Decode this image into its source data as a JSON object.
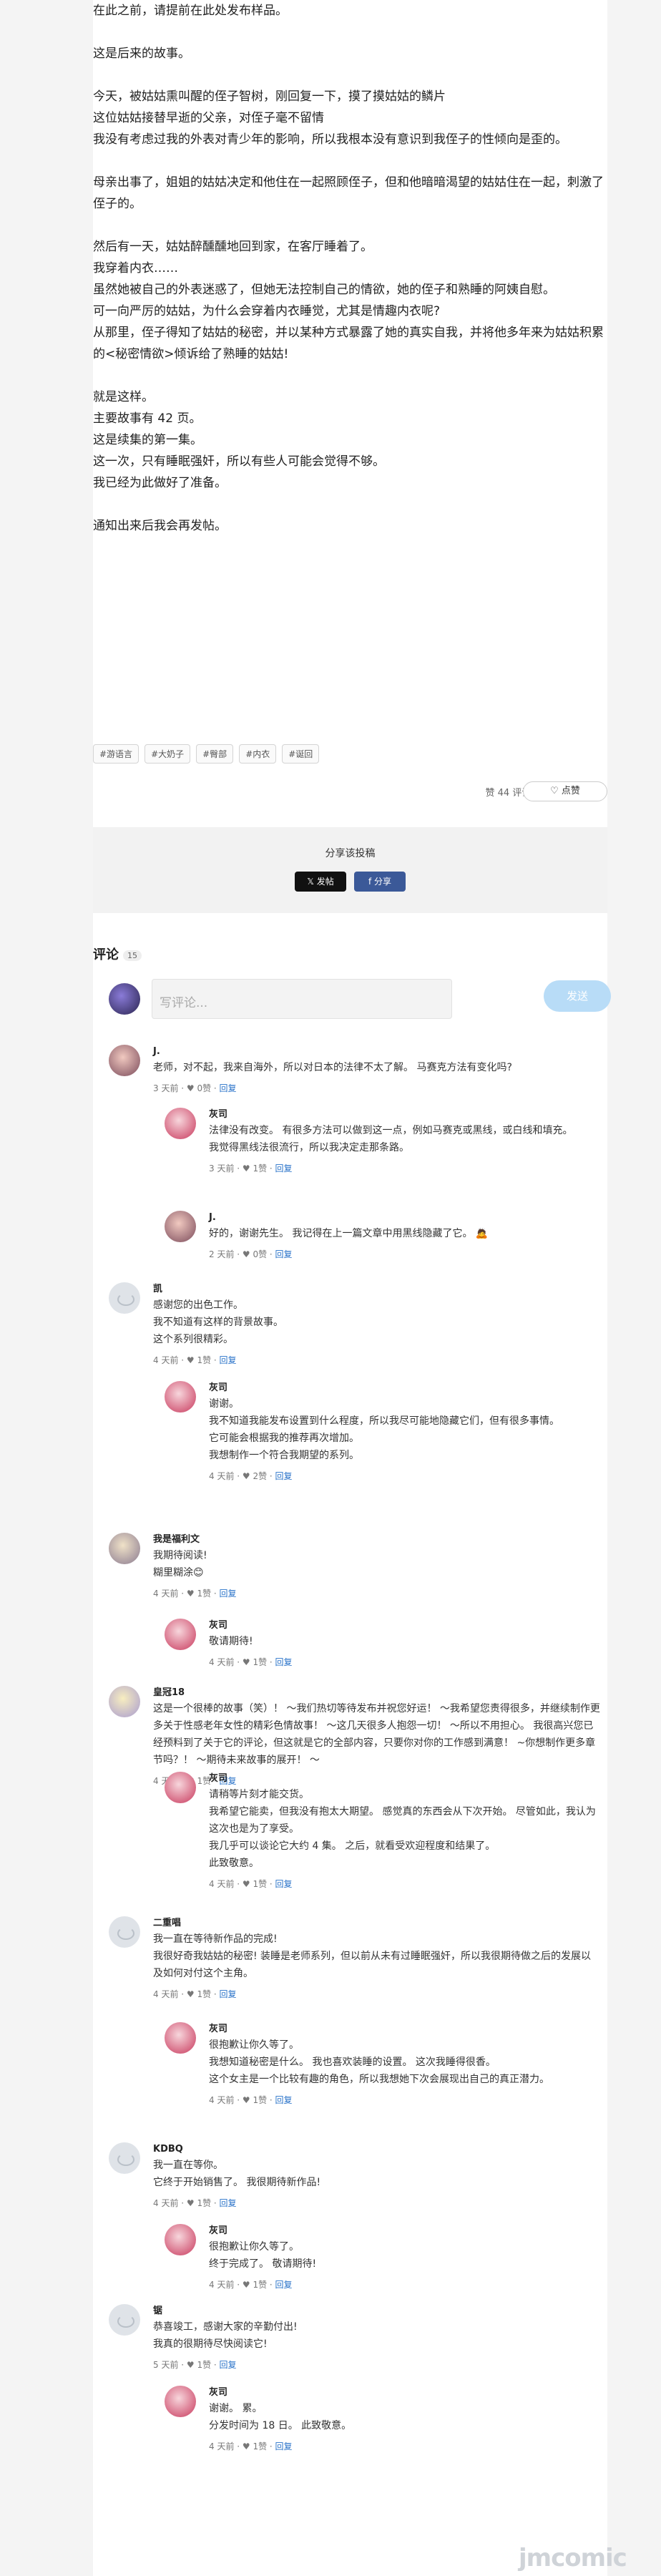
{
  "article": {
    "paragraphs": [
      [
        "在此之前，请提前在此处发布样品。"
      ],
      [
        "这是后来的故事。"
      ],
      [
        "今天，被姑姑熏叫醒的侄子智树，刚回复一下，摸了摸姑姑的鳞片",
        "这位姑姑接替早逝的父亲，对侄子毫不留情",
        "我没有考虑过我的外表对青少年的影响，所以我根本没有意识到我侄子的性倾向是歪的。"
      ],
      [
        "母亲出事了，姐姐的姑姑决定和他住在一起照顾侄子，但和他暗暗渴望的姑姑住在一起，刺激了侄子的。"
      ],
      [
        "然后有一天，姑姑醉醺醺地回到家，在客厅睡着了。",
        "我穿着内衣……",
        "虽然她被自己的外表迷惑了，但她无法控制自己的情欲，她的侄子和熟睡的阿姨自慰。",
        "可一向严厉的姑姑，为什么会穿着内衣睡觉，尤其是情趣内衣呢?",
        "从那里，侄子得知了姑姑的秘密，并以某种方式暴露了她的真实自我，并将他多年来为姑姑积累的<秘密情欲>倾诉给了熟睡的姑姑!"
      ],
      [
        "就是这样。",
        "主要故事有 42 页。",
        "这是续集的第一集。",
        "这一次，只有睡眠强奸，所以有些人可能会觉得不够。",
        "我已经为此做好了准备。"
      ],
      [
        "通知出来后我会再发帖。"
      ]
    ],
    "tags": [
      "#游语言",
      "#大奶子",
      "#臀部",
      "#内衣",
      "#诞回"
    ],
    "likes_text": "赞 44  评论 15",
    "like_button": "点赞"
  },
  "share": {
    "title": "分享该投稿",
    "x_label": "发帖",
    "fb_label": "分享"
  },
  "comments_section": {
    "title": "评论",
    "count": "15",
    "input_placeholder": "写评论...",
    "send_label": "发送"
  },
  "comments": [
    {
      "name": "J.",
      "lines": [
        "老师，对不起，我来自海外，所以对日本的法律不太了解。 马赛克方法有变化吗?"
      ],
      "meta": "3 天前 · ♥ 0赞 · ",
      "reply": "回复",
      "avatar": "j",
      "indent": false
    },
    {
      "name": "灰司",
      "lines": [
        "法律没有改变。 有很多方法可以做到这一点，例如马赛克或黑线，或白线和填充。",
        "我觉得黑线法很流行，所以我决定走那条路。"
      ],
      "meta": "3 天前 · ♥ 1赞 · ",
      "reply": "回复",
      "avatar": "author",
      "indent": true
    },
    {
      "name": "J.",
      "lines": [
        "好的，谢谢先生。 我记得在上一篇文章中用黑线隐藏了它。 🙇"
      ],
      "meta": "2 天前 · ♥ 0赞 · ",
      "reply": "回复",
      "avatar": "j",
      "indent": true
    },
    {
      "name": "凯",
      "lines": [
        "感谢您的出色工作。",
        "我不知道有这样的背景故事。",
        "这个系列很精彩。"
      ],
      "meta": "4 天前 · ♥ 1赞 · ",
      "reply": "回复",
      "avatar": "grey",
      "indent": false
    },
    {
      "name": "灰司",
      "lines": [
        "谢谢。",
        "我不知道我能发布设置到什么程度，所以我尽可能地隐藏它们，但有很多事情。",
        "它可能会根据我的推荐再次增加。",
        "我想制作一个符合我期望的系列。"
      ],
      "meta": "4 天前 · ♥ 2赞 · ",
      "reply": "回复",
      "avatar": "author",
      "indent": true
    },
    {
      "name": "我是福利文",
      "lines": [
        "我期待阅读!",
        "糊里糊涂😊"
      ],
      "meta": "4 天前 · ♥ 1赞 · ",
      "reply": "回复",
      "avatar": "cc",
      "indent": false
    },
    {
      "name": "灰司",
      "lines": [
        "敬请期待!"
      ],
      "meta": "4 天前 · ♥ 1赞 · ",
      "reply": "回复",
      "avatar": "author",
      "indent": true
    },
    {
      "name": "皇冠18",
      "lines": [
        "这是一个很棒的故事（笑）！ ～我们热切等待发布并祝您好运！ ～我希望您责得很多，并继续制作更多关于性感老年女性的精彩色情故事！ ～这几天很多人抱怨一切！ ～所以不用担心。 我很高兴您已经预料到了关于它的评论，但这就是它的全部内容，只要你对你的工作感到满意！ ~你想制作更多章节吗？！ ～期待未来故事的展开！ 〜"
      ],
      "meta": "4 天前 · ♥ 1赞 · ",
      "reply": "回复",
      "avatar": "ht",
      "indent": false
    },
    {
      "name": "灰司",
      "lines": [
        "请稍等片刻才能交货。",
        "我希望它能卖，但我没有抱太大期望。 感觉真的东西会从下次开始。 尽管如此，我认为这次也是为了享受。",
        "我几乎可以谈论它大约 4 集。 之后，就看受欢迎程度和结果了。",
        "此致敬意。"
      ],
      "meta": "4 天前 · ♥ 1赞 · ",
      "reply": "回复",
      "avatar": "author",
      "indent": true
    },
    {
      "name": "二重唱",
      "lines": [
        "我一直在等待新作品的完成!",
        "我很好奇我姑姑的秘密! 装睡是老师系列，但以前从未有过睡眠强奸，所以我很期待做之后的发展以及如何对付这个主角。"
      ],
      "meta": "4 天前 · ♥ 1赞 · ",
      "reply": "回复",
      "avatar": "grey",
      "indent": false
    },
    {
      "name": "灰司",
      "lines": [
        "很抱歉让你久等了。",
        "我想知道秘密是什么。 我也喜欢装睡的设置。 这次我睡得很香。",
        "这个女主是一个比较有趣的角色，所以我想她下次会展现出自己的真正潜力。"
      ],
      "meta": "4 天前 · ♥ 1赞 · ",
      "reply": "回复",
      "avatar": "author",
      "indent": true
    },
    {
      "name": "KDBQ",
      "lines": [
        "我一直在等你。",
        "它终于开始销售了。 我很期待新作品!"
      ],
      "meta": "4 天前 · ♥ 1赞 · ",
      "reply": "回复",
      "avatar": "grey",
      "indent": false
    },
    {
      "name": "灰司",
      "lines": [
        "很抱歉让你久等了。",
        "终于完成了。 敬请期待!"
      ],
      "meta": "4 天前 · ♥ 1赞 · ",
      "reply": "回复",
      "avatar": "author",
      "indent": true
    },
    {
      "name": "锯",
      "lines": [
        "恭喜竣工，感谢大家的辛勤付出!",
        "我真的很期待尽快阅读它!"
      ],
      "meta": "5 天前 · ♥ 1赞 · ",
      "reply": "回复",
      "avatar": "grey",
      "indent": false
    },
    {
      "name": "灰司",
      "lines": [
        "谢谢。 累。",
        "分发时间为 18 日。 此致敬意。"
      ],
      "meta": "4 天前 · ♥ 1赞 · ",
      "reply": "回复",
      "avatar": "author",
      "indent": true
    }
  ],
  "footer": {
    "logo": "jmcomic"
  }
}
